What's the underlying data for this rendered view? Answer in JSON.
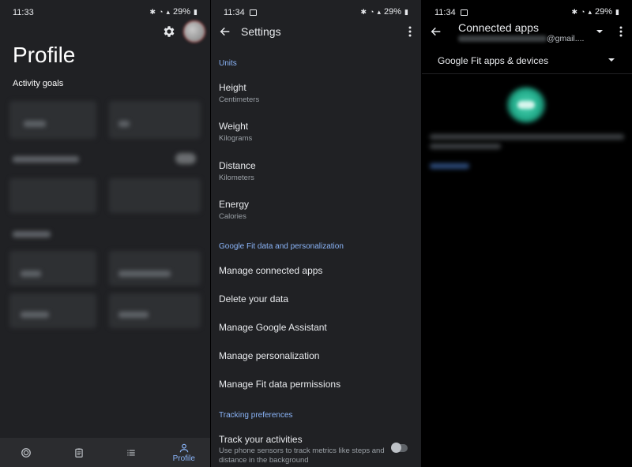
{
  "panel1": {
    "status": {
      "time": "11:33",
      "battery": "29%"
    },
    "title": "Profile",
    "section": "Activity goals",
    "nav": {
      "profile_label": "Profile"
    }
  },
  "panel2": {
    "status": {
      "time": "11:34",
      "battery": "29%"
    },
    "appbar": {
      "title": "Settings"
    },
    "sections": {
      "units": "Units",
      "personalization": "Google Fit data and personalization",
      "tracking": "Tracking preferences"
    },
    "units": [
      {
        "primary": "Height",
        "secondary": "Centimeters"
      },
      {
        "primary": "Weight",
        "secondary": "Kilograms"
      },
      {
        "primary": "Distance",
        "secondary": "Kilometers"
      },
      {
        "primary": "Energy",
        "secondary": "Calories"
      }
    ],
    "data_items": [
      "Manage connected apps",
      "Delete your data",
      "Manage Google Assistant",
      "Manage personalization",
      "Manage Fit data permissions"
    ],
    "tracking": {
      "title": "Track your activities",
      "description": "Use phone sensors to track metrics like steps and distance in the background",
      "enabled": false
    }
  },
  "panel3": {
    "status": {
      "time": "11:34",
      "battery": "29%"
    },
    "appbar": {
      "title": "Connected apps"
    },
    "account_suffix": "@gmail....",
    "dropdown": {
      "selected": "Google Fit apps & devices"
    }
  },
  "colors": {
    "accent": "#8ab4f8",
    "surface": "#202124",
    "black": "#000000",
    "teal": "#1fa988"
  }
}
